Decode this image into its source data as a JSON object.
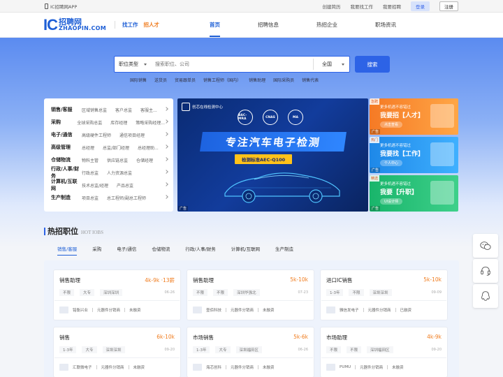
{
  "topbar": {
    "app_label": "IC招聘网APP",
    "links": [
      "创建简历",
      "我要找工作",
      "我要招聘"
    ],
    "login": "登录",
    "register": "注册"
  },
  "header": {
    "logo_ic": "IC",
    "logo_cn": "招聘网",
    "logo_en": "ZHAOPIN.COM",
    "find_job": "找工作",
    "find_talent": "招人才",
    "nav": [
      "首页",
      "招聘信息",
      "热招企业",
      "职场资讯"
    ]
  },
  "search": {
    "type_label": "职位类型",
    "placeholder": "搜索职位、公司",
    "city": "全国",
    "button": "搜索",
    "hot_words": [
      "国际销售",
      "送货员",
      "贸易跟单员",
      "销售工程师（国内）",
      "销售助理",
      "国际采购员",
      "销售代表"
    ]
  },
  "categories": [
    {
      "head": "销售/客服",
      "subs": [
        "区域销售总监",
        "客户总监",
        "客服主..."
      ]
    },
    {
      "head": "采购",
      "subs": [
        "全球采购总监",
        "库存经理",
        "策略采购经理..."
      ]
    },
    {
      "head": "电子/通信",
      "subs": [
        "高级硬件工程师",
        "通信项目经理"
      ]
    },
    {
      "head": "高级管理",
      "subs": [
        "总经理",
        "总监/部门经理",
        "总经理助..."
      ]
    },
    {
      "head": "仓储物流",
      "subs": [
        "物料主管",
        "供应链总监",
        "仓储经理"
      ]
    },
    {
      "head": "行政/人事/财务",
      "subs": [
        "行政总监",
        "人力资源总监"
      ]
    },
    {
      "head": "计算机/互联网",
      "subs": [
        "技术总监/经理",
        "产品总监"
      ]
    },
    {
      "head": "生产制造",
      "subs": [
        "项目总监",
        "总工程师/副总工程师"
      ]
    }
  ],
  "banner": {
    "org": "创芯在线检测中心",
    "badges": [
      "BAC-MRA",
      "CNAS",
      "MA"
    ],
    "title": "专注汽车电子检测",
    "subtitle": "检测标准AEC-Q100",
    "ad": "广告"
  },
  "side_ads": [
    {
      "tag": "急聘",
      "line1": "更多机遇不容错过",
      "line2": "我要招【人才】",
      "pill": "点击查看",
      "ad": "广告"
    },
    {
      "tag": "热门",
      "line1": "更多机遇不容错过",
      "line2": "我要找【工作】",
      "pill": "个人中心",
      "ad": "广告"
    },
    {
      "tag": "精选",
      "line1": "更多机遇不容错过",
      "line2": "我要【升职】",
      "pill": "UI设计师",
      "ad": "广告"
    }
  ],
  "hot": {
    "title": "热招职位",
    "title_en": "HOT IOBS",
    "tabs": [
      "销售/客服",
      "采购",
      "电子/通信",
      "仓储物流",
      "行政/人事/财务",
      "计算机/互联网",
      "生产制造"
    ]
  },
  "jobs": [
    {
      "title": "销售助理",
      "salary": "4k-9k ·13薪",
      "tags": [
        "不限",
        "大专",
        "深圳深圳"
      ],
      "date": "06-26",
      "company": "铭衡兴业",
      "industry": "元器件分销商",
      "funding": "未融资"
    },
    {
      "title": "销售助理",
      "salary": "5k-10k",
      "tags": [
        "不限",
        "不限",
        "深圳华强北"
      ],
      "date": "07-23",
      "company": "壹佰科技",
      "industry": "元器件分销商",
      "funding": "未融资"
    },
    {
      "title": "进口IC销售",
      "salary": "5k-10k",
      "tags": [
        "1-3年",
        "不限",
        "深圳深圳"
      ],
      "date": "09-09",
      "company": "雅信发电子",
      "industry": "元器件分销商",
      "funding": "已融资"
    },
    {
      "title": "销售",
      "salary": "6k-10k",
      "tags": [
        "1-3年",
        "大专",
        "深圳深圳"
      ],
      "date": "09-20",
      "company": "汇联微电子",
      "industry": "元器件分销商",
      "funding": "未融资"
    },
    {
      "title": "市场销售",
      "salary": "5k-6k",
      "tags": [
        "1-3年",
        "大专",
        "深圳福田区"
      ],
      "date": "06-26",
      "company": "海芯创科",
      "industry": "元器件分销商",
      "funding": "未融资"
    },
    {
      "title": "市场助理",
      "salary": "4k-9k",
      "tags": [
        "不限",
        "不限",
        "深圳福田区"
      ],
      "date": "09-20",
      "company": "PUMU",
      "industry": "元器件分销商",
      "funding": "未融资"
    }
  ],
  "float_icons": [
    "wechat-icon",
    "headset-icon",
    "qq-icon"
  ]
}
